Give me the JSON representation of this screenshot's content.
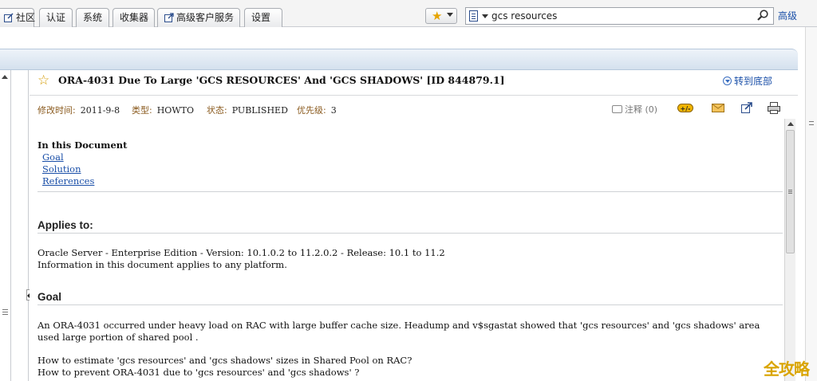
{
  "tabs": [
    {
      "label": "社区",
      "icon": "edit-icon"
    },
    {
      "label": "认证"
    },
    {
      "label": "系统"
    },
    {
      "label": "收集器"
    },
    {
      "label": "高级客户服务",
      "icon": "external-link-icon"
    },
    {
      "label": "设置"
    }
  ],
  "search": {
    "value": "gcs resources",
    "advanced_label": "高级"
  },
  "document": {
    "title": "ORA-4031 Due To Large 'GCS RESOURCES' And 'GCS SHADOWS' [ID 844879.1]",
    "jump_bottom_label": "转到底部",
    "meta": {
      "modified_key": "修改时间:",
      "modified_value": "2011-9-8",
      "type_key": "类型:",
      "type_value": "HOWTO",
      "status_key": "状态:",
      "status_value": "PUBLISHED",
      "priority_key": "优先级:",
      "priority_value": "3"
    },
    "notes_label": "注释",
    "notes_count": "(0)",
    "actions": [
      "rate-icon",
      "email-icon",
      "open-window-icon",
      "print-icon"
    ],
    "toc_heading": "In this Document",
    "toc": [
      "Goal",
      "Solution",
      "References"
    ],
    "applies_heading": "Applies to:",
    "applies_lines": [
      "Oracle Server - Enterprise Edition - Version: 10.1.0.2 to 11.2.0.2 - Release: 10.1 to 11.2",
      "Information in this document applies to any platform."
    ],
    "goal_heading": "Goal",
    "goal_para": "An ORA-4031 occurred under heavy load on RAC with large buffer cache size.  Headump and v$sgastat showed that 'gcs resources' and 'gcs shadows' area used large portion of shared pool .",
    "goal_q1": "How to estimate 'gcs resources' and 'gcs shadows' sizes in Shared Pool on RAC?",
    "goal_q2": "How to prevent ORA-4031 due to 'gcs resources' and 'gcs shadows' ?"
  },
  "watermark": "全攻略",
  "colors": {
    "link": "#1a4fa8",
    "meta_key": "#8a5a1e",
    "header_blue": "#d5e1ee",
    "watermark": "#d9a400"
  }
}
